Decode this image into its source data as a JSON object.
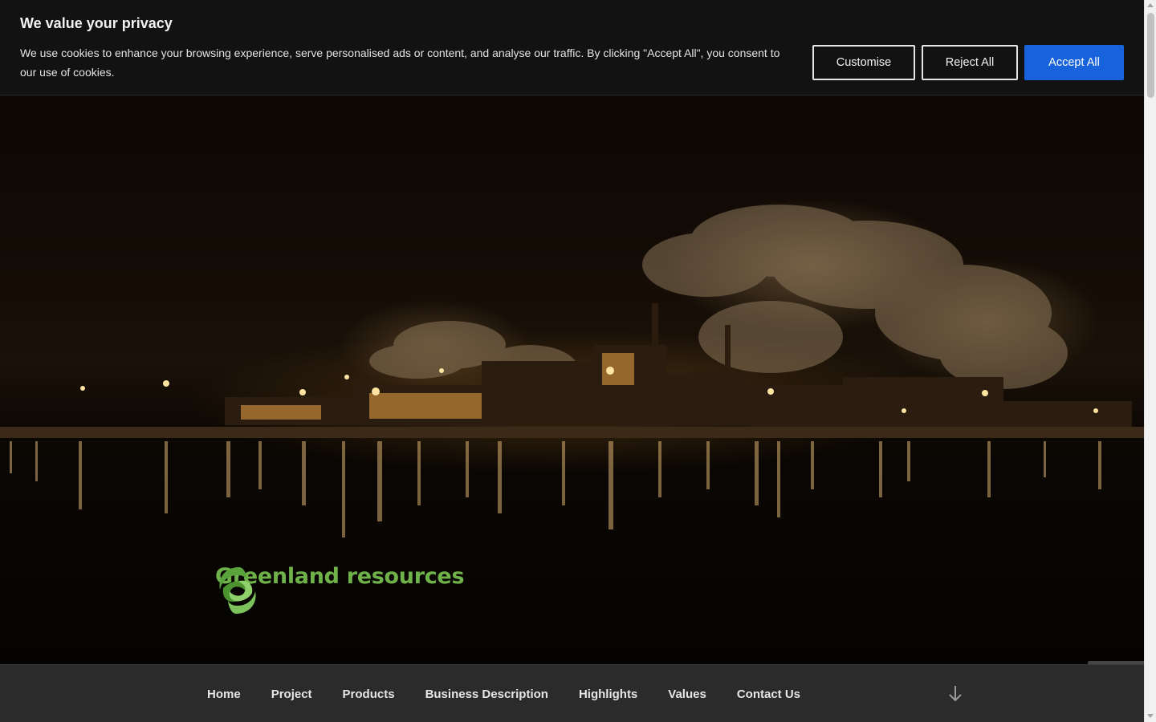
{
  "cookie_banner": {
    "title": "We value your privacy",
    "message": "We use cookies to enhance your browsing experience, serve personalised ads or content, and analyse our traffic. By clicking \"Accept All\", you consent to our use of cookies.",
    "buttons": {
      "customise": "Customise",
      "reject_all": "Reject All",
      "accept_all": "Accept All"
    },
    "accent_color": "#1863dc"
  },
  "hero": {
    "logo_text": "Greenland resources",
    "logo_icon": "swirl-logo-icon",
    "logo_color": "#6fb24a"
  },
  "nav": {
    "items": [
      {
        "label": "Home"
      },
      {
        "label": "Project"
      },
      {
        "label": "Products"
      },
      {
        "label": "Business Description"
      },
      {
        "label": "Highlights"
      },
      {
        "label": "Values"
      },
      {
        "label": "Contact Us"
      }
    ],
    "scroll_icon": "arrow-down-icon"
  }
}
